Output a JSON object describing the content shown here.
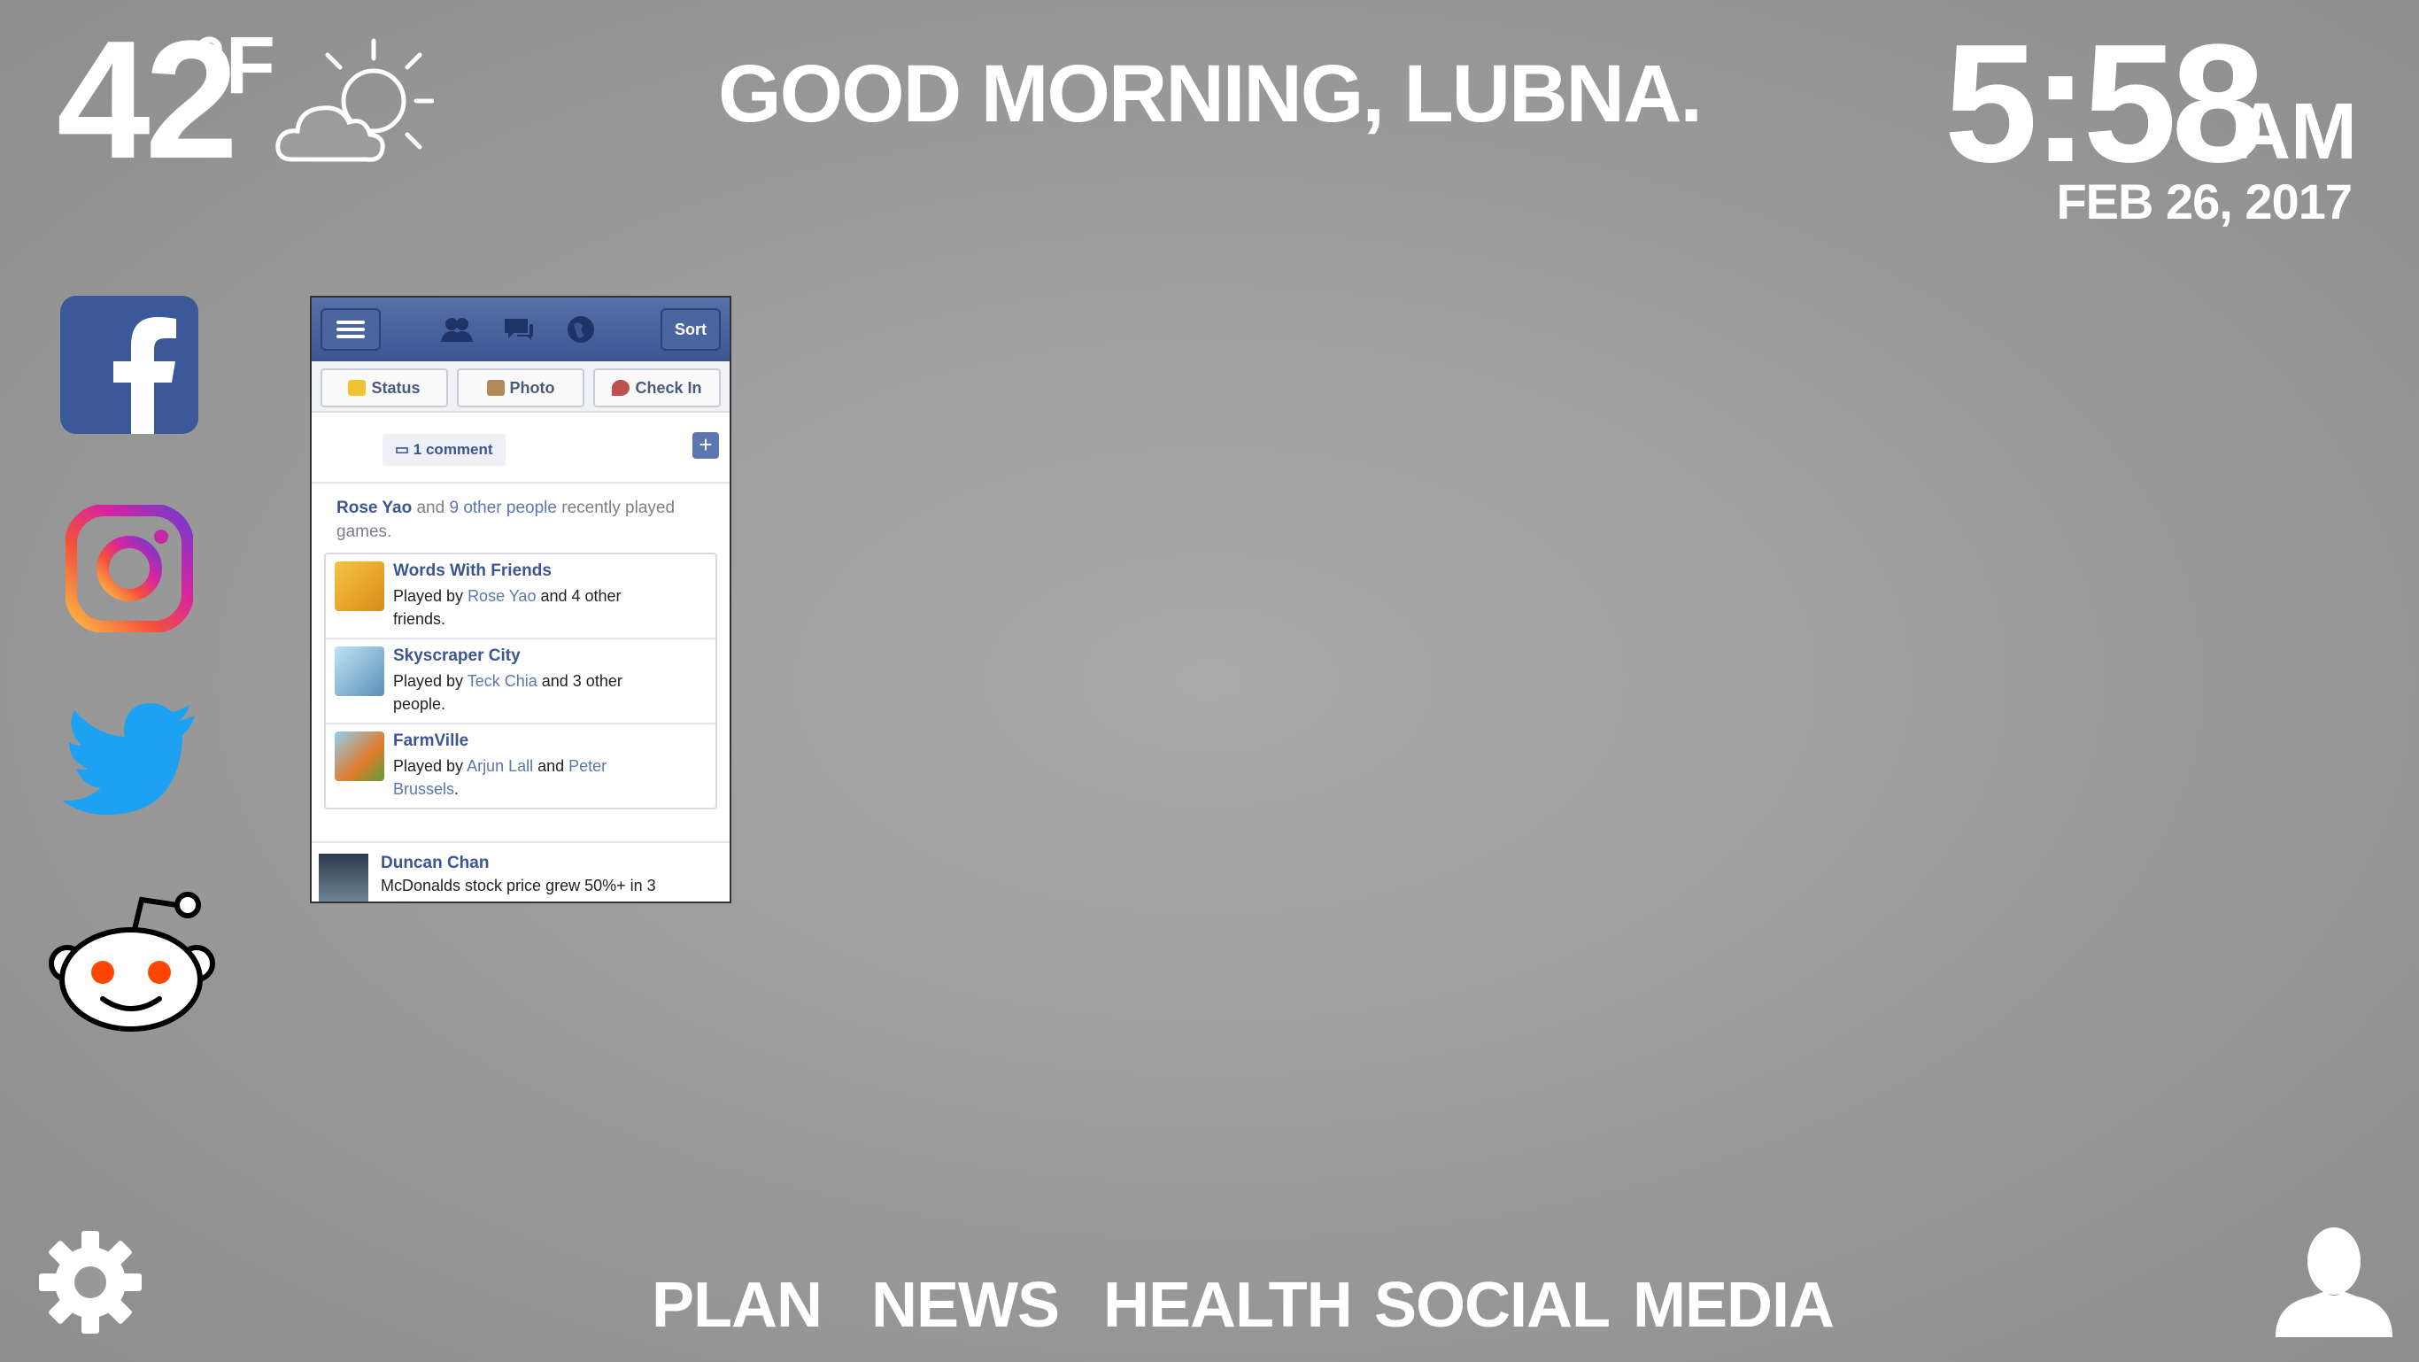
{
  "weather": {
    "temperature": "42",
    "unit": "°F",
    "condition_icon": "partly-cloudy-sun-icon"
  },
  "greeting": "GOOD MORNING, LUBNA.",
  "clock": {
    "time": "5:58",
    "ampm": "AM",
    "date": "FEB 26, 2017"
  },
  "social_apps": [
    {
      "name": "facebook-icon",
      "color": "#3b5998"
    },
    {
      "name": "instagram-icon",
      "color": "#d6249f"
    },
    {
      "name": "twitter-icon",
      "color": "#1da1f2"
    },
    {
      "name": "reddit-icon",
      "color": "#ff4500"
    }
  ],
  "facebook_feed": {
    "sort_label": "Sort",
    "actions": [
      "Status",
      "Photo",
      "Check In"
    ],
    "comment_label": "1 comment",
    "story": {
      "name": "Rose Yao",
      "text_a": " and ",
      "others": "9 other people",
      "text_b": " recently played games."
    },
    "games": [
      {
        "title": "Words With Friends",
        "prefix": "Played by ",
        "friend": "Rose Yao",
        "suffix": " and 4 other friends."
      },
      {
        "title": "Skyscraper City",
        "prefix": "Played by ",
        "friend": "Teck Chia",
        "suffix": " and 3 other people."
      },
      {
        "title": "FarmVille",
        "prefix": "Played by ",
        "friend": "Arjun Lall",
        "mid": " and ",
        "friend2": "Peter Brussels",
        "suffix": "."
      }
    ],
    "post": {
      "name": "Duncan Chan",
      "text": "McDonalds stock price grew 50%+ in 3"
    }
  },
  "nav": [
    "PLAN",
    "NEWS",
    "HEALTH",
    "SOCIAL",
    "MEDIA"
  ]
}
